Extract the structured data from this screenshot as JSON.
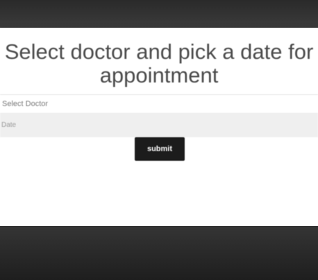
{
  "form": {
    "title": "Select doctor and pick a date for appointment",
    "doctor_select_value": "Select Doctor",
    "date_placeholder": "Date",
    "submit_label": "submit"
  }
}
